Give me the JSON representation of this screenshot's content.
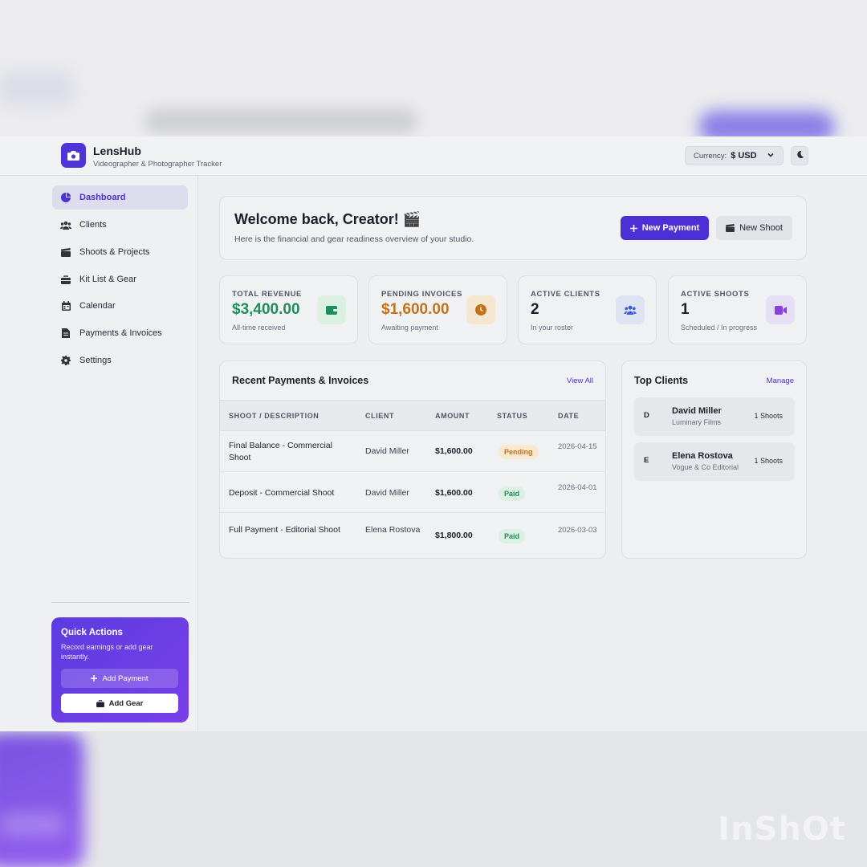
{
  "app": {
    "name": "LensHub",
    "tagline": "Videographer & Photographer Tracker",
    "currency_label": "Currency:",
    "currency_value": "$ USD"
  },
  "sidebar": {
    "items": [
      {
        "label": "Dashboard",
        "icon": "pie-chart-icon",
        "active": true
      },
      {
        "label": "Clients",
        "icon": "users-icon",
        "active": false
      },
      {
        "label": "Shoots & Projects",
        "icon": "clapperboard-icon",
        "active": false
      },
      {
        "label": "Kit List & Gear",
        "icon": "toolbox-icon",
        "active": false
      },
      {
        "label": "Calendar",
        "icon": "calendar-icon",
        "active": false
      },
      {
        "label": "Payments & Invoices",
        "icon": "invoice-icon",
        "active": false
      },
      {
        "label": "Settings",
        "icon": "gear-icon",
        "active": false
      }
    ],
    "quick_actions": {
      "title": "Quick Actions",
      "description": "Record earnings or add gear instantly.",
      "add_payment": "Add Payment",
      "add_gear": "Add Gear"
    }
  },
  "welcome": {
    "title": "Welcome back, Creator! 🎬",
    "subtitle": "Here is the financial and gear readiness overview of your studio.",
    "new_payment": "New Payment",
    "new_shoot": "New Shoot"
  },
  "stats": [
    {
      "label": "TOTAL REVENUE",
      "value": "$3,400.00",
      "note": "All-time received",
      "color": "#1e8f5c",
      "icon": "wallet-icon"
    },
    {
      "label": "PENDING INVOICES",
      "value": "$1,600.00",
      "note": "Awaiting payment",
      "color": "#c2731a",
      "icon": "clock-icon"
    },
    {
      "label": "ACTIVE CLIENTS",
      "value": "2",
      "note": "In your roster",
      "color": "#1c1f2b",
      "icon": "users-icon"
    },
    {
      "label": "ACTIVE SHOOTS",
      "value": "1",
      "note": "Scheduled / In progress",
      "color": "#1c1f2b",
      "icon": "video-icon"
    }
  ],
  "payments": {
    "title": "Recent Payments & Invoices",
    "view_all": "View All",
    "columns": [
      "SHOOT / DESCRIPTION",
      "CLIENT",
      "AMOUNT",
      "STATUS",
      "DATE"
    ],
    "rows": [
      {
        "description": "Final Balance - Commercial Shoot",
        "client": "David Miller",
        "amount": "$1,600.00",
        "status": "Pending",
        "date": "2026-04-15"
      },
      {
        "description": "Deposit - Commercial Shoot",
        "client": "David Miller",
        "amount": "$1,600.00",
        "status": "Paid",
        "date": "2026-04-01"
      },
      {
        "description": "Full Payment - Editorial Shoot",
        "client": "Elena Rostova",
        "amount": "$1,800.00",
        "status": "Paid",
        "date": "2026-03-03"
      }
    ]
  },
  "top_clients": {
    "title": "Top Clients",
    "manage": "Manage",
    "items": [
      {
        "initial": "D",
        "name": "David Miller",
        "org": "Luminary Films",
        "count": "1 Shoots"
      },
      {
        "initial": "E",
        "name": "Elena Rostova",
        "org": "Vogue & Co Editorial",
        "count": "1 Shoots"
      }
    ]
  },
  "watermark": "InShOt",
  "colors": {
    "accent": "#4c30d6",
    "pending_bg": "#f7e8cf",
    "pending_text": "#c2731a",
    "paid_bg": "#dcefe3",
    "paid_text": "#1e8f5c"
  }
}
